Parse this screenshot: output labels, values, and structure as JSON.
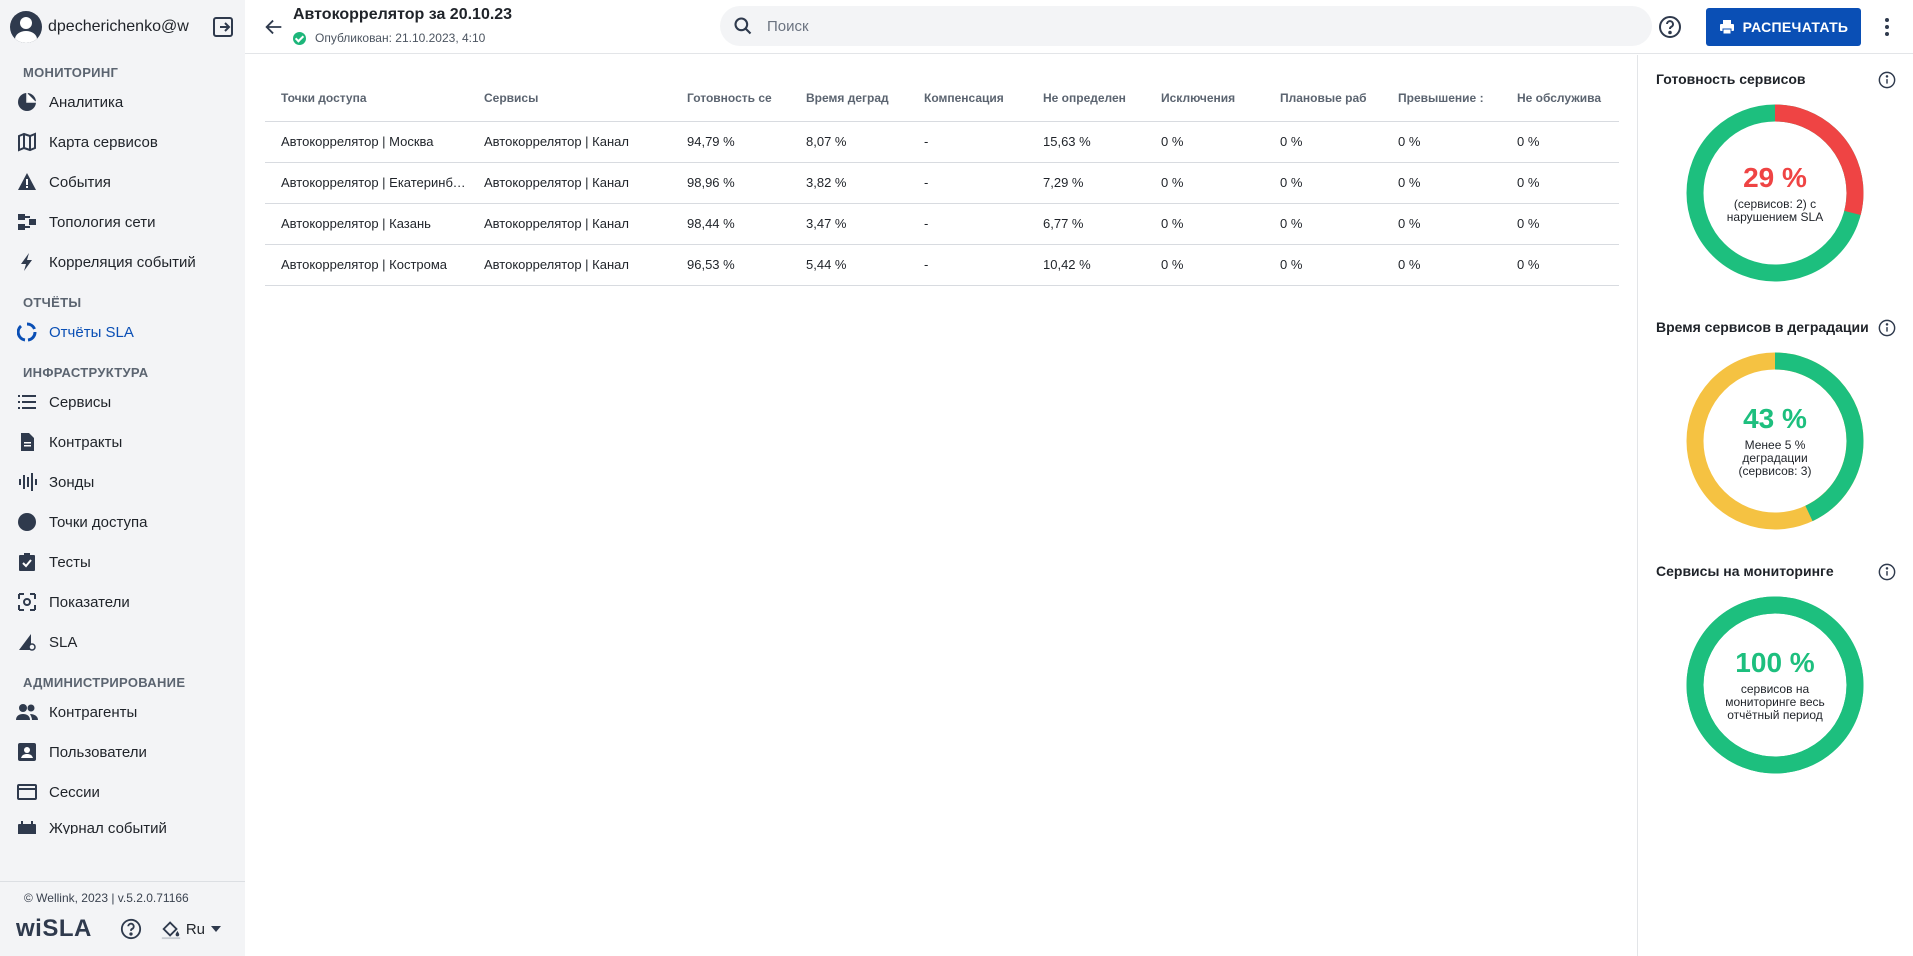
{
  "user": {
    "name": "dpecherichenko@w"
  },
  "nav": {
    "monitoring_title": "МОНИТОРИНГ",
    "analytics": "Аналитика",
    "service_map": "Карта сервисов",
    "events": "События",
    "topology": "Топология сети",
    "correlation": "Корреляция событий",
    "reports_title": "ОТЧЁТЫ",
    "sla_reports": "Отчёты SLA",
    "infra_title": "ИНФРАСТРУКТУРА",
    "services": "Сервисы",
    "contracts": "Контракты",
    "probes": "Зонды",
    "access_points": "Точки доступа",
    "tests": "Тесты",
    "indicators": "Показатели",
    "sla": "SLA",
    "admin_title": "АДМИНИСТРИРОВАНИЕ",
    "counterparties": "Контрагенты",
    "users": "Пользователи",
    "sessions": "Сессии",
    "event_log": "Журнал событий"
  },
  "footer": {
    "copyright": "© Wellink, 2023 | v.5.2.0.71166",
    "logo": "wiSLA",
    "lang": "Ru"
  },
  "header": {
    "title": "Автокоррелятор за 20.10.23",
    "status": "Опубликован: 21.10.2023, 4:10",
    "search_placeholder": "Поиск",
    "print_label": "РАСПЕЧАТАТЬ"
  },
  "table": {
    "columns": [
      "Точки доступа",
      "Сервисы",
      "Готовность се",
      "Время деград",
      "Компенсация",
      "Не определен",
      "Исключения",
      "Плановые раб",
      "Превышение :",
      "Не обслужива"
    ],
    "rows": [
      [
        "Автокоррелятор | Москва",
        "Автокоррелятор | Канал",
        "94,79 %",
        "8,07 %",
        "-",
        "15,63 %",
        "0 %",
        "0 %",
        "0 %",
        "0 %"
      ],
      [
        "Автокоррелятор | Екатеринбург",
        "Автокоррелятор | Канал",
        "98,96 %",
        "3,82 %",
        "-",
        "7,29 %",
        "0 %",
        "0 %",
        "0 %",
        "0 %"
      ],
      [
        "Автокоррелятор | Казань",
        "Автокоррелятор | Канал",
        "98,44 %",
        "3,47 %",
        "-",
        "6,77 %",
        "0 %",
        "0 %",
        "0 %",
        "0 %"
      ],
      [
        "Автокоррелятор | Кострома",
        "Автокоррелятор | Канал",
        "96,53 %",
        "5,44 %",
        "-",
        "10,42 %",
        "0 %",
        "0 %",
        "0 %",
        "0 %"
      ]
    ]
  },
  "widgets": [
    {
      "title": "Готовность сервисов",
      "percent": "29 %",
      "description": "(сервисов: 2) с нарушением SLA",
      "value": 29,
      "color": "#ef4444",
      "rest_color": "#1dbf7e",
      "text_color": "#ef4444"
    },
    {
      "title": "Время сервисов в деградации",
      "percent": "43 %",
      "description": "Менее 5 % деградации (сервисов: 3)",
      "value": 43,
      "color": "#1dbf7e",
      "rest_color": "#f5c242",
      "text_color": "#1dbf7e"
    },
    {
      "title": "Сервисы на мониторинге",
      "percent": "100 %",
      "description": "сервисов на мониторинге весь отчётный период",
      "value": 100,
      "color": "#1dbf7e",
      "rest_color": "#1dbf7e",
      "text_color": "#1dbf7e"
    }
  ],
  "colors": {
    "accent": "#0a4fb5",
    "green": "#1dbf7e",
    "red": "#ef4444",
    "yellow": "#f5c242"
  },
  "icons": [
    "user-avatar-icon",
    "logout-icon",
    "back-arrow-icon",
    "search-icon",
    "help-icon",
    "printer-icon",
    "more-vertical-icon",
    "info-icon"
  ]
}
